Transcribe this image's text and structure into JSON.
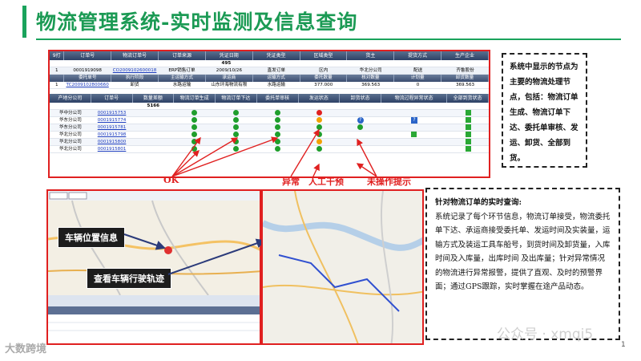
{
  "title": "物流管理系统-实时监测及信息查询",
  "grid": {
    "toolbar_left": "9打",
    "order_cols": [
      "订单号",
      "物流订单号",
      "订单来源",
      "凭证日期",
      "凭证类型",
      "区域类型",
      "货主",
      "提货方式",
      "生产企业"
    ],
    "order_count": "495",
    "order_row": {
      "idx": "1",
      "order_no": "0001919098",
      "logistics_no": "CO2009102600018",
      "source": "ERP销售订单",
      "date": "2009/10/26",
      "type": "直发订单",
      "region": "区内",
      "owner": "华北分公司",
      "pickup": "配送",
      "maker": "齐鲁股份"
    },
    "commission_cols": [
      "委托单号",
      "执行阶段",
      "主运输方式",
      "承运商",
      "运输方式",
      "委托数量",
      "核对数量",
      "计划量",
      "卸货数量"
    ],
    "commission_row": {
      "idx": "1",
      "no": "TC2009102800660",
      "stage": "卸货",
      "main_mode": "水路运输",
      "carrier": "山东环海物流有限",
      "mode": "水路运输",
      "qty": "377.000",
      "checked": "369.563",
      "plan": "0",
      "unload": "369.563"
    },
    "status_cols": [
      "产地分公司",
      "订单号",
      "数量差额",
      "物流订单生成",
      "物流订单下达",
      "委托单审核",
      "发运状态",
      "卸货状态",
      "物流过程异常状态",
      "全部到货状态"
    ],
    "status_count": "5166",
    "status_rows": [
      {
        "branch": "华中分公司",
        "order": "0001915753",
        "s": [
          "g",
          "g",
          "g",
          "r",
          "",
          "",
          "g"
        ]
      },
      {
        "branch": "华东分公司",
        "order": "0001915774",
        "s": [
          "g",
          "g",
          "g",
          "o",
          "q",
          "q",
          "g"
        ]
      },
      {
        "branch": "华东分公司",
        "order": "0001915781",
        "s": [
          "g",
          "g",
          "g",
          "g",
          "g",
          "",
          "g"
        ]
      },
      {
        "branch": "华北分公司",
        "order": "0001915798",
        "s": [
          "g",
          "g",
          "g",
          "g",
          "",
          "g",
          "g"
        ]
      },
      {
        "branch": "华北分公司",
        "order": "0001915800",
        "s": [
          "g",
          "g",
          "g",
          "o",
          "",
          "",
          "g"
        ]
      },
      {
        "branch": "华北分公司",
        "order": "0001915801",
        "s": [
          "g",
          "g",
          "g",
          "g",
          "",
          "",
          "g"
        ]
      }
    ]
  },
  "labels": {
    "ok": "OK",
    "abnormal": "异常",
    "manual": "人工干预",
    "not_operated": "未操作提示"
  },
  "box1": "系统中显示的节点为主要的物流处理节点，包括：物流订单生成、物流订单下达、委托单审核、发运、卸货、全部到货。",
  "box2": {
    "head": "针对物流订单的实时查询:",
    "body": "系统记录了每个环节信息，物流订单接受，物流委托单下达、承运商接受委托单、发运时间及实装量，运输方式及装运工具车船号，到货时间及卸货量，入库时间及入库量，出库时间 及出库量；针对异常情况的物流进行异常报警，提供了直观、及时的预警界面；通过GPS跟踪，实时掌握在途产品动态。"
  },
  "callouts": {
    "vehicle_location": "车辆位置信息",
    "view_track": "查看车辆行驶轨迹"
  },
  "footer": "大数跨境",
  "watermark": "公众号 · xmqi5",
  "page_no": "1"
}
